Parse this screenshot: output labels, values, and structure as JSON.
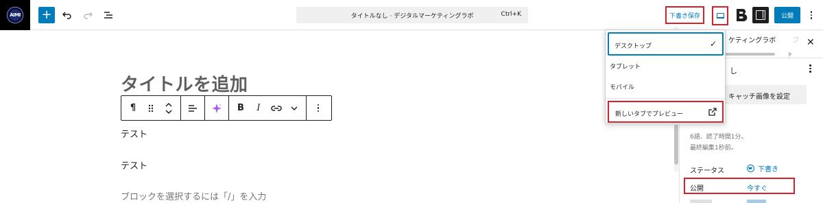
{
  "topbar": {
    "logo_text": "AIMI",
    "add_icon": "plus-icon",
    "undo_icon": "undo-icon",
    "redo_icon": "redo-icon",
    "outline_icon": "list-view-icon",
    "document_title": "タイトルなし · デジタルマーケティングラボ",
    "shortcut": "Ctrl+K",
    "save_draft_label": "下書き保存",
    "preview_icon": "desktop-icon",
    "plugin_icon": "b-logo-icon",
    "sidebar_toggle_icon": "sidebar-icon",
    "publish_label": "公開",
    "more_icon": "more-vertical-icon"
  },
  "editor": {
    "title_placeholder": "タイトルを追加",
    "toolbar": {
      "paragraph_icon": "¶",
      "drag_icon": "drag-handle-icon",
      "move_icon": "move-up-down-icon",
      "align_icon": "align-left-icon",
      "ai_icon": "sparkle-icon",
      "bold": "B",
      "italic": "I",
      "link_icon": "link-icon",
      "more_rich_icon": "chevron-down-icon",
      "options_icon": "more-vertical-icon"
    },
    "paragraphs": [
      "テスト",
      "テスト"
    ],
    "block_placeholder": "ブロックを選択するには「/」を入力"
  },
  "preview_menu": {
    "items": [
      {
        "label": "デスクトップ",
        "selected": true
      },
      {
        "label": "タブレット",
        "selected": false
      },
      {
        "label": "モバイル",
        "selected": false
      }
    ],
    "check": "✓",
    "new_tab_label": "新しいタブでプレビュー",
    "external_icon": "external-link-icon"
  },
  "sidebar": {
    "tab_partial": "ケティングラボ",
    "tab_faded": "ブ",
    "close_icon": "close-icon",
    "post_name_partial": "し",
    "featured_image_label": "キャッチ画像を設定",
    "meta_words": "6語、読了時間1分。",
    "meta_edited": "最終編集1秒前。",
    "status_label": "ステータス",
    "status_value": "下書き",
    "publish_label": "公開",
    "publish_value": "今すぐ"
  },
  "colors": {
    "accent": "#007cba",
    "highlight": "#d6202c",
    "ai_purple": "#a855f7"
  }
}
